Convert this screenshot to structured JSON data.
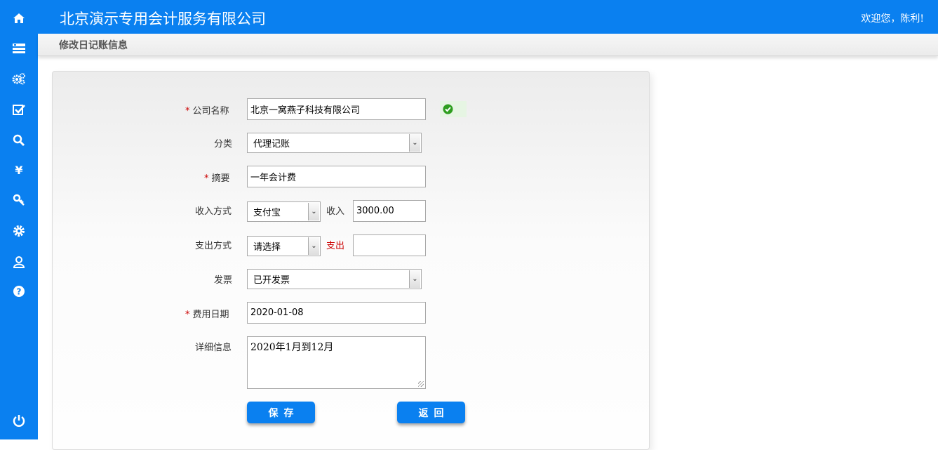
{
  "header": {
    "company": "北京演示专用会计服务有限公司",
    "welcome": "欢迎您，陈利!"
  },
  "page_title": "修改日记账信息",
  "sidebar": {
    "icons": [
      "home-icon",
      "list-icon",
      "settings-gears-icon",
      "check-icon",
      "search-icon",
      "yen-icon",
      "key-icon",
      "gear-icon",
      "user-icon",
      "help-icon",
      "power-icon"
    ]
  },
  "form": {
    "company_label": "公司名称",
    "company_value": "北京一窝燕子科技有限公司",
    "category_label": "分类",
    "category_value": "代理记账",
    "summary_label": "摘要",
    "summary_value": "一年会计费",
    "income_method_label": "收入方式",
    "income_method_value": "支付宝",
    "income_label": "收入",
    "income_value": "3000.00",
    "expense_method_label": "支出方式",
    "expense_method_value": "请选择",
    "expense_label": "支出",
    "expense_value": "",
    "invoice_label": "发票",
    "invoice_value": "已开发票",
    "date_label": "费用日期",
    "date_value": "2020-01-08",
    "detail_label": "详细信息",
    "detail_value": "2020年1月到12月",
    "required_mark": "*",
    "save_label": "保存",
    "back_label": "返回"
  },
  "colors": {
    "brand": "#0a80f0",
    "required": "#cc0000",
    "ok": "#2e9e1f"
  }
}
